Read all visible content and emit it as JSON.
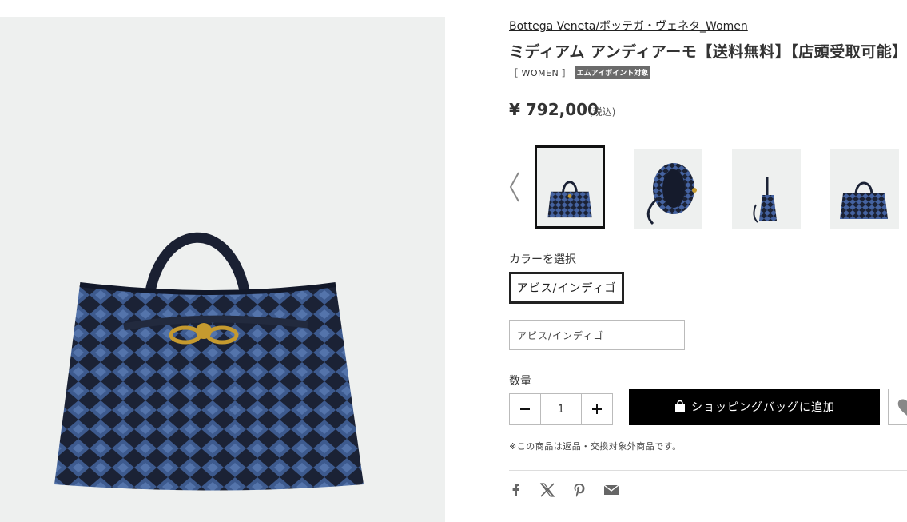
{
  "product": {
    "brand": "Bottega Veneta/ボッテガ・ヴェネタ_Women",
    "title": "ミディアム アンディアーモ【送料無料】【店頭受取可能】",
    "category_tag": "［ WOMEN ］",
    "badge": "エムアイポイント対象",
    "price": "¥ 792,000",
    "tax_note": "(税込)"
  },
  "gallery": {
    "thumbnails": [
      "front",
      "interior",
      "side",
      "front-small"
    ],
    "selected_index": 0
  },
  "color": {
    "label": "カラーを選択",
    "selected_chip": "アビス/インディゴ",
    "select_value": "アビス/インディゴ"
  },
  "quantity": {
    "label": "数量",
    "value": "1",
    "minus_icon": "minus-icon",
    "plus_icon": "plus-icon"
  },
  "cart": {
    "add_label": "ショッピングバッグに追加"
  },
  "notice": "※この商品は返品・交換対象外商品です。",
  "share": [
    "facebook-icon",
    "x-icon",
    "pinterest-icon",
    "mail-icon"
  ],
  "colors": {
    "bag_dark": "#1c2438",
    "bag_blue": "#3a5586",
    "gold": "#c59a2f",
    "bg": "#eef0ef"
  }
}
